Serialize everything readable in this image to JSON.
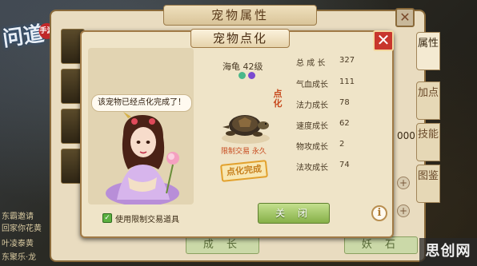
{
  "background": {
    "logo_text": "问道",
    "logo_badge": "手游",
    "chat_lines": [
      "东霸邀请",
      "回家你花黄",
      "叶凌泰黄",
      "东聚乐·龙"
    ],
    "back_panel": {
      "title": "宠物属性",
      "close_symbol": "✕",
      "side_tabs": [
        "属性",
        "加点",
        "技能",
        "图鉴"
      ],
      "value_fragment": "000",
      "bottom_buttons": [
        "成 长",
        "妖 石"
      ]
    }
  },
  "dialog": {
    "title": "宠物点化",
    "close_symbol": "✕",
    "speech": "该宠物已经点化完成了！",
    "checkbox_checked": true,
    "checkbox_mark": "✓",
    "checkbox_label": "使用限制交易道具",
    "pet": {
      "name": "海龟 42级",
      "dianhua_vertical": "点化",
      "trade_note": "限制交易 永久",
      "stamp": "点化完成"
    },
    "stats": [
      {
        "label": "总 成 长",
        "value": "327"
      },
      {
        "label": "气血成长",
        "value": "111"
      },
      {
        "label": "法力成长",
        "value": "78"
      },
      {
        "label": "速度成长",
        "value": "62"
      },
      {
        "label": "物攻成长",
        "value": "2"
      },
      {
        "label": "法攻成长",
        "value": "74"
      }
    ],
    "ok_button": "关 闭",
    "info_symbol": "i"
  },
  "watermark": "思创网",
  "colors": {
    "panel_bg": "#efe4c8",
    "close_red": "#c8362c",
    "ok_green": "#86b048",
    "accent_orange": "#c74a1e"
  }
}
